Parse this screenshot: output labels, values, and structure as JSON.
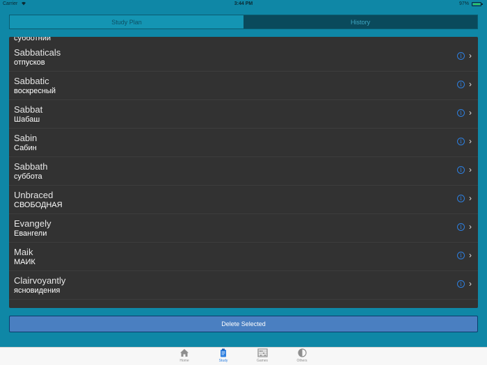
{
  "status_bar": {
    "carrier": "Carrier",
    "time": "3:44 PM",
    "battery": "97%"
  },
  "segmented": {
    "tabs": [
      {
        "label": "Study Plan",
        "selected": false
      },
      {
        "label": "History",
        "selected": true
      }
    ]
  },
  "list": {
    "partial_item": "субботний",
    "items": [
      {
        "word": "Sabbaticals",
        "translation": "отпусков"
      },
      {
        "word": "Sabbatic",
        "translation": "воскресный"
      },
      {
        "word": "Sabbat",
        "translation": "Шабаш"
      },
      {
        "word": "Sabin",
        "translation": "Сабин"
      },
      {
        "word": "Sabbath",
        "translation": "суббота"
      },
      {
        "word": "Unbraced",
        "translation": "СВОБОДНАЯ"
      },
      {
        "word": "Evangely",
        "translation": "Евангели"
      },
      {
        "word": "Maik",
        "translation": "МАИК"
      },
      {
        "word": "Clairvoyantly",
        "translation": "ясновидения"
      }
    ]
  },
  "delete_button": {
    "label": "Delete Selected"
  },
  "tabbar": {
    "items": [
      {
        "label": "Home",
        "icon": "house-icon"
      },
      {
        "label": "Study",
        "icon": "clipboard-icon",
        "active": true
      },
      {
        "label": "Games",
        "icon": "abacus-icon"
      },
      {
        "label": "Others",
        "icon": "half-circle-icon"
      }
    ]
  },
  "colors": {
    "background": "#0f87a6",
    "list_background": "#323232",
    "accent": "#2d7fe0",
    "delete_button": "#4a7fc1"
  }
}
